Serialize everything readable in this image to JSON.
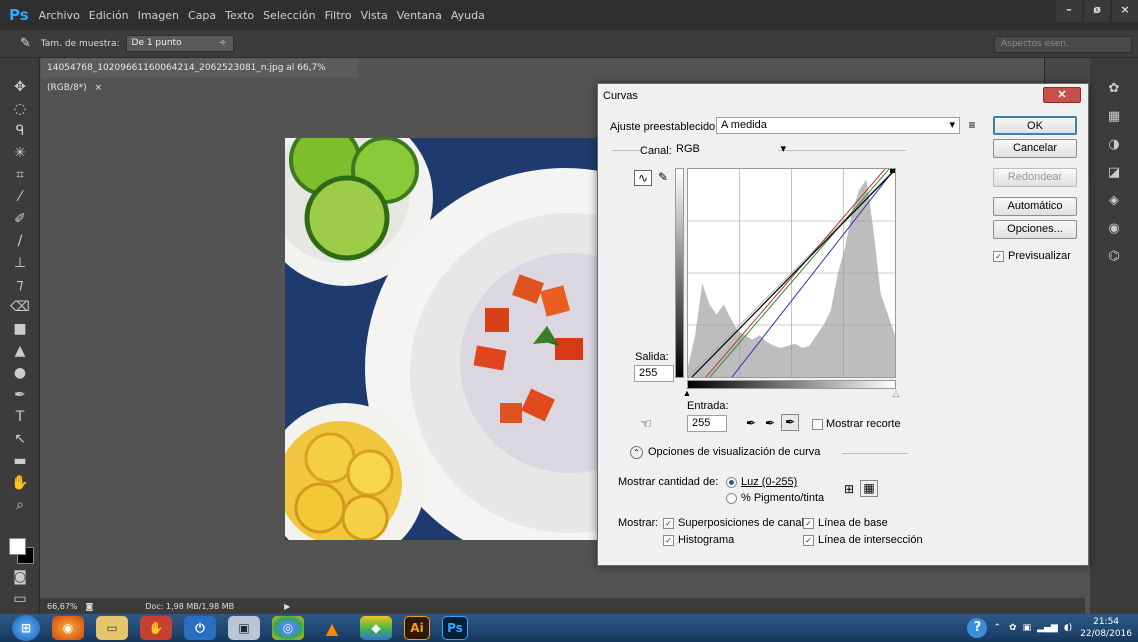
{
  "app": {
    "logo": "Ps",
    "menu": [
      "Archivo",
      "Edición",
      "Imagen",
      "Capa",
      "Texto",
      "Selección",
      "Filtro",
      "Vista",
      "Ventana",
      "Ayuda"
    ]
  },
  "options": {
    "sample_label": "Tam. de muestra:",
    "sample_value": "De 1 punto",
    "workspace": "Aspectos esen."
  },
  "document": {
    "tab": "14054768_10209661160064214_2062523081_n.jpg al 66,7% (RGB/8*)",
    "close": "×"
  },
  "status": {
    "zoom": "66,67%",
    "doc": "Doc: 1,98 MB/1,98 MB"
  },
  "window_controls": {
    "minimize": "–",
    "restore": "ø",
    "close": "×"
  },
  "dialog": {
    "title": "Curvas",
    "preset_label": "Ajuste preestablecido:",
    "preset_value": "A medida",
    "channel_label": "Canal:",
    "channel_value": "RGB",
    "output_label": "Salida:",
    "output_value": "255",
    "input_label": "Entrada:",
    "input_value": "255",
    "show_clipping": "Mostrar recorte",
    "display_options": "Opciones de visualización de curva",
    "show_amount_label": "Mostrar cantidad de:",
    "light_option": "Luz (0-255)",
    "pigment_option": "% Pigmento/tinta",
    "show_label": "Mostrar:",
    "channel_overlays": "Superposiciones de canal",
    "baseline": "Línea de base",
    "histogram": "Histograma",
    "intersection": "Línea de intersección",
    "preview": "Previsualizar",
    "buttons": {
      "ok": "OK",
      "cancel": "Cancelar",
      "smooth": "Redondear",
      "auto": "Automático",
      "options": "Opciones..."
    }
  },
  "colors": {
    "curve_red": "#c0392b",
    "curve_green": "#2e8b3a",
    "curve_blue": "#3333aa",
    "curve_rgb": "#000000",
    "histogram": "#bdbdbd"
  },
  "tray": {
    "time": "21:54",
    "date": "22/08/2016"
  },
  "taskbar": {
    "ps": "Ps",
    "ai": "Ai"
  }
}
